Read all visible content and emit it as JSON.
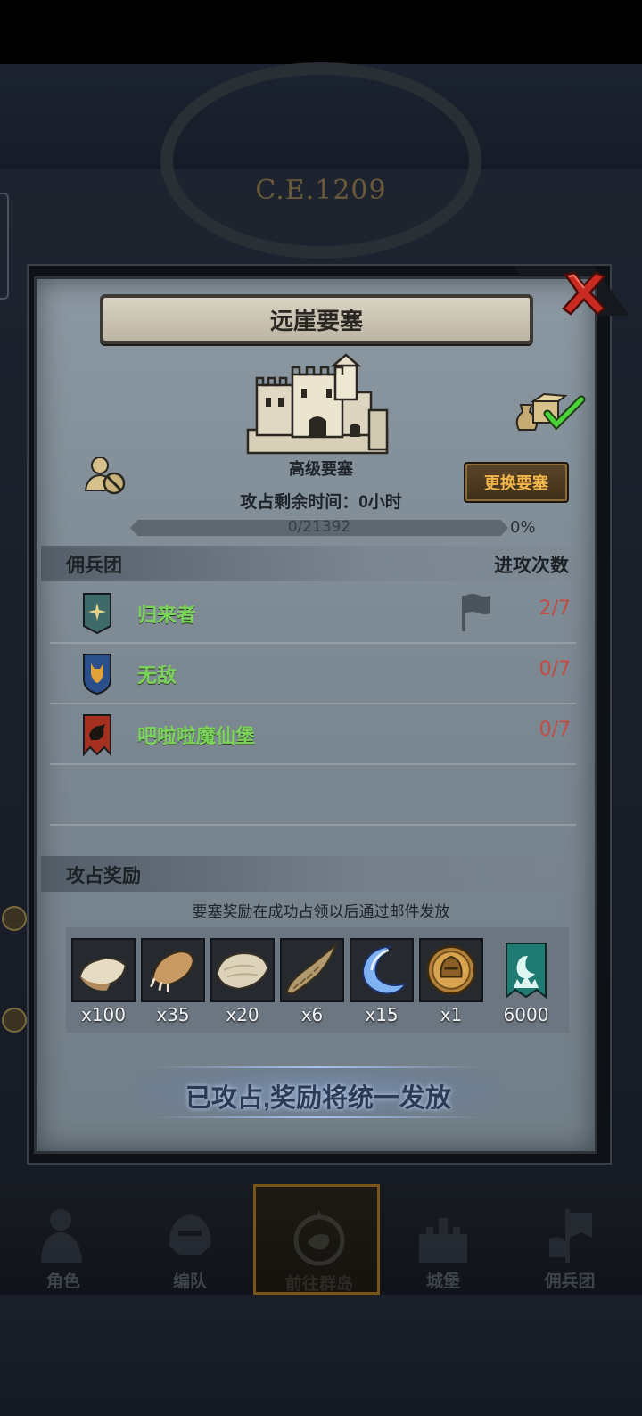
{
  "background": {
    "date": "C.E.1209"
  },
  "panel": {
    "title": "远崖要塞",
    "fortress_type": "高级要塞",
    "occupy_time": "攻占剩余时间：0小时",
    "change_button": "更换要塞",
    "progress": {
      "text": "0/21392",
      "percent": "0%",
      "value": 0
    }
  },
  "mercenary": {
    "header_left": "佣兵团",
    "header_right": "进攻次数",
    "rows": [
      {
        "name": "归来者",
        "count": "2/7",
        "emblem": "star-banner-icon",
        "emblem_color": "#3f6a6a",
        "flag": true
      },
      {
        "name": "无敌",
        "count": "0/7",
        "emblem": "fox-shield-icon",
        "emblem_color": "#2b4f8a",
        "flag": false
      },
      {
        "name": "吧啦啦魔仙堡",
        "count": "0/7",
        "emblem": "crow-banner-icon",
        "emblem_color": "#a6301f",
        "flag": false
      }
    ]
  },
  "rewards": {
    "header": "攻占奖励",
    "note": "要塞奖励在成功占领以后通过邮件发放",
    "items": [
      {
        "icon": "hide-icon",
        "qty": "x100"
      },
      {
        "icon": "claw-icon",
        "qty": "x35"
      },
      {
        "icon": "fur-icon",
        "qty": "x20"
      },
      {
        "icon": "horn-icon",
        "qty": "x6"
      },
      {
        "icon": "moon-crystal-icon",
        "qty": "x15"
      },
      {
        "icon": "helmet-medal-icon",
        "qty": "x1"
      },
      {
        "icon": "guild-banner-icon",
        "qty": "6000"
      }
    ]
  },
  "claim_text": "已攻占,奖励将统一发放",
  "nav": [
    {
      "label": "角色",
      "icon": "knight-icon",
      "active": false
    },
    {
      "label": "编队",
      "icon": "helmet-icon",
      "active": false
    },
    {
      "label": "前往群岛",
      "icon": "compass-icon",
      "active": true
    },
    {
      "label": "城堡",
      "icon": "castle-icon",
      "active": false
    },
    {
      "label": "佣兵团",
      "icon": "banner-icon",
      "active": false
    }
  ],
  "colors": {
    "accent_gold": "#f2b64a",
    "name_green": "#7bd35a",
    "count_red": "#c44a44"
  }
}
